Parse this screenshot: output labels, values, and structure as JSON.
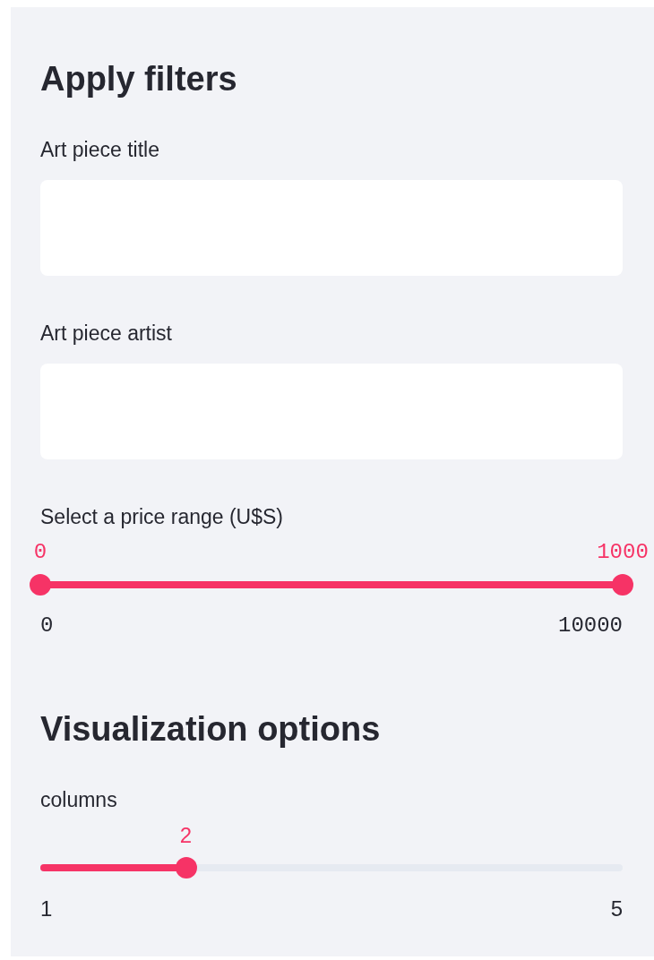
{
  "sections": [
    {
      "heading": "Apply filters",
      "widgets": [
        {
          "kind": "text_input",
          "label": "Art piece title"
        },
        {
          "kind": "text_input",
          "label": "Art piece artist"
        },
        {
          "kind": "range_slider",
          "label": "Select a price range (U$S)",
          "thumbs": [
            {
              "value": "0",
              "level": 0
            },
            {
              "value": "1000",
              "level": 1
            }
          ],
          "min_label": "0",
          "max_label": "10000"
        }
      ]
    },
    {
      "heading": "Visualization options",
      "widgets": [
        {
          "kind": "slider",
          "label": "columns",
          "thumbs": [
            {
              "value": "2",
              "level": 0.25
            }
          ],
          "min_label": "1",
          "max_label": "5"
        }
      ]
    }
  ]
}
